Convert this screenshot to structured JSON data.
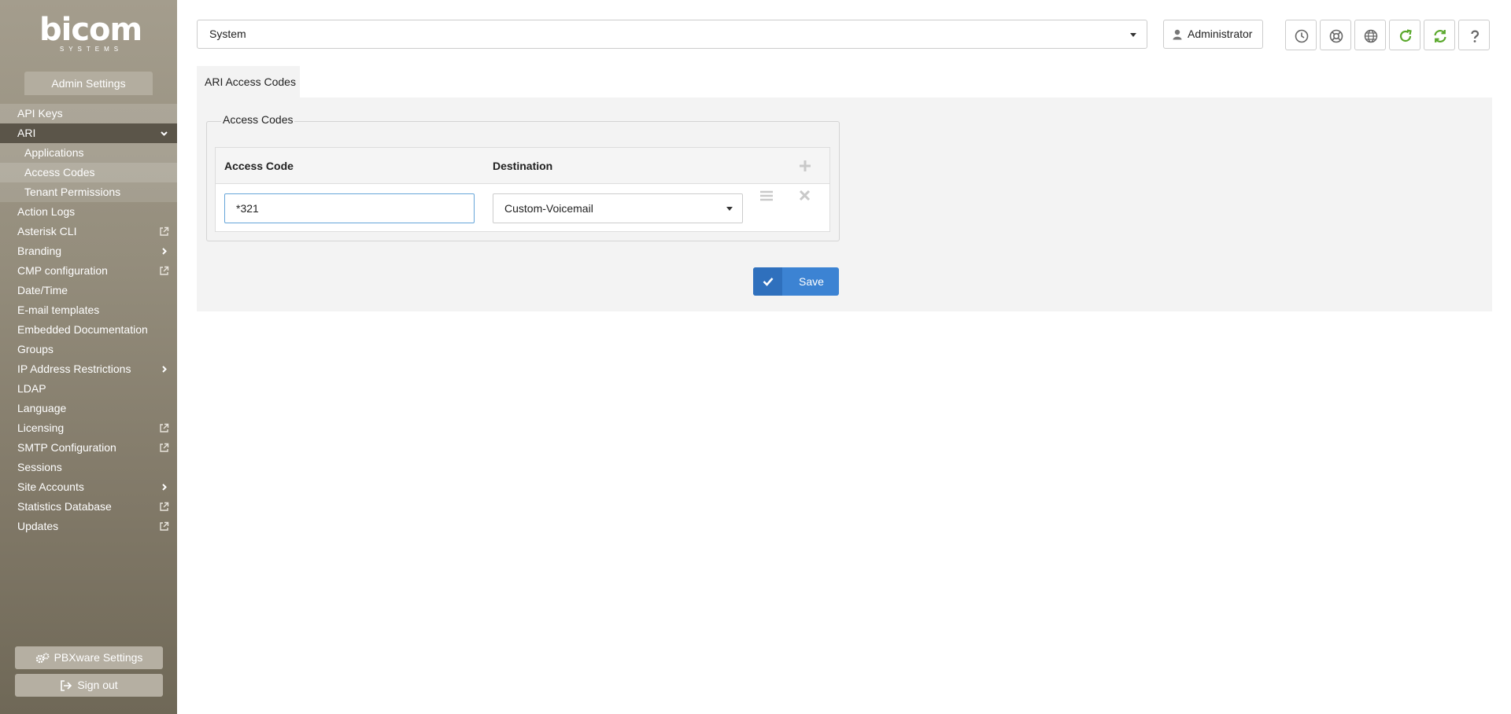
{
  "logo": {
    "main": "bicom",
    "sub": "SYSTEMS"
  },
  "sidebar": {
    "title": "Admin Settings",
    "items": [
      {
        "label": "API Keys"
      },
      {
        "label": "ARI"
      },
      {
        "label": "Applications"
      },
      {
        "label": "Access Codes"
      },
      {
        "label": "Tenant Permissions"
      },
      {
        "label": "Action Logs"
      },
      {
        "label": "Asterisk CLI"
      },
      {
        "label": "Branding"
      },
      {
        "label": "CMP configuration"
      },
      {
        "label": "Date/Time"
      },
      {
        "label": "E-mail templates"
      },
      {
        "label": "Embedded Documentation"
      },
      {
        "label": "Groups"
      },
      {
        "label": "IP Address Restrictions"
      },
      {
        "label": "LDAP"
      },
      {
        "label": "Language"
      },
      {
        "label": "Licensing"
      },
      {
        "label": "SMTP Configuration"
      },
      {
        "label": "Sessions"
      },
      {
        "label": "Site Accounts"
      },
      {
        "label": "Statistics Database"
      },
      {
        "label": "Updates"
      }
    ],
    "pbxware_settings": "PBXware Settings",
    "sign_out": "Sign out"
  },
  "header": {
    "system_select": "System",
    "user_button": "Administrator"
  },
  "main": {
    "tab_label": "ARI Access Codes",
    "fieldset_legend": "Access Codes",
    "table": {
      "columns": [
        "Access Code",
        "Destination"
      ],
      "rows": [
        {
          "access_code": "*321",
          "destination": "Custom-Voicemail"
        }
      ]
    },
    "save_label": "Save"
  },
  "colors": {
    "accent": "#3c83d3",
    "refresh_green": "#5aa82c",
    "sidebar_top": "#a49d8d",
    "sidebar_bottom": "#6f6857"
  }
}
